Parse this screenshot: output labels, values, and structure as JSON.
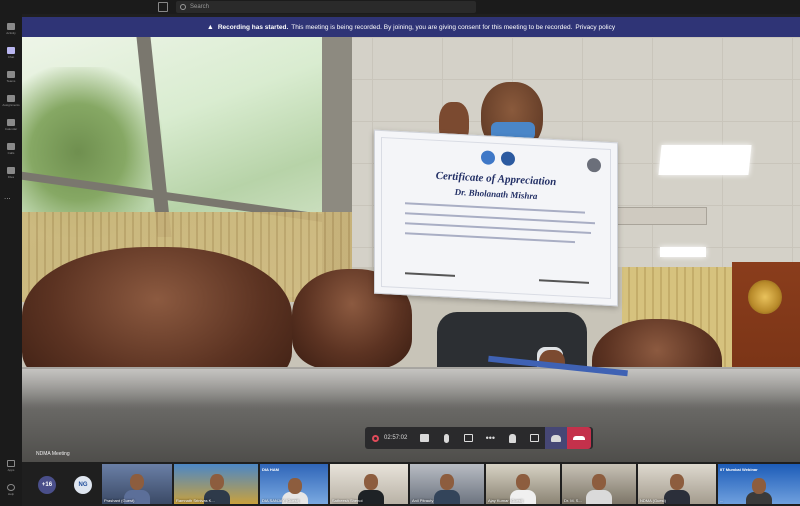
{
  "topbar": {
    "search_placeholder": "Search"
  },
  "rail": {
    "items": [
      {
        "label": "Activity"
      },
      {
        "label": "Chat"
      },
      {
        "label": "Teams"
      },
      {
        "label": "Assignments"
      },
      {
        "label": "Calendar"
      },
      {
        "label": "Calls"
      },
      {
        "label": "Files"
      }
    ],
    "more": "...",
    "bottom": [
      {
        "label": "Apps"
      },
      {
        "label": "Help"
      }
    ]
  },
  "banner": {
    "title": "Recording has started.",
    "text": "This meeting is being recorded. By joining, you are giving consent for this meeting to be recorded.",
    "link": "Privacy policy"
  },
  "certificate": {
    "title": "Certificate of Appreciation",
    "name": "Dr. Bholanath Mishra"
  },
  "controls": {
    "timer": "02:57:02",
    "more": "•••"
  },
  "meeting_label": "NDMA Meeting",
  "participants": {
    "overflow": "+16",
    "initials": "NG",
    "tiles": [
      {
        "name": "Prashant (Guest)",
        "banner": ""
      },
      {
        "name": "Ramnath Srinivas K...",
        "banner": ""
      },
      {
        "name": "DIA SANJAY (Guest)",
        "banner": "DIA HAM"
      },
      {
        "name": "Satheesh Shenoi",
        "banner": ""
      },
      {
        "name": "Anil Pitrauty",
        "banner": ""
      },
      {
        "name": "Ajay Kumar (Guest)",
        "banner": ""
      },
      {
        "name": "Dr. M. S...",
        "banner": ""
      },
      {
        "name": "NDMA (Guest)",
        "banner": ""
      },
      {
        "name": "...",
        "banner": "IIT Mumbai  Webinar"
      }
    ]
  },
  "colors": {
    "banner_bg": "#2f3476",
    "hangup": "#c4314b",
    "active_ctrl": "#464775",
    "recording_dot": "#e04b5a"
  }
}
